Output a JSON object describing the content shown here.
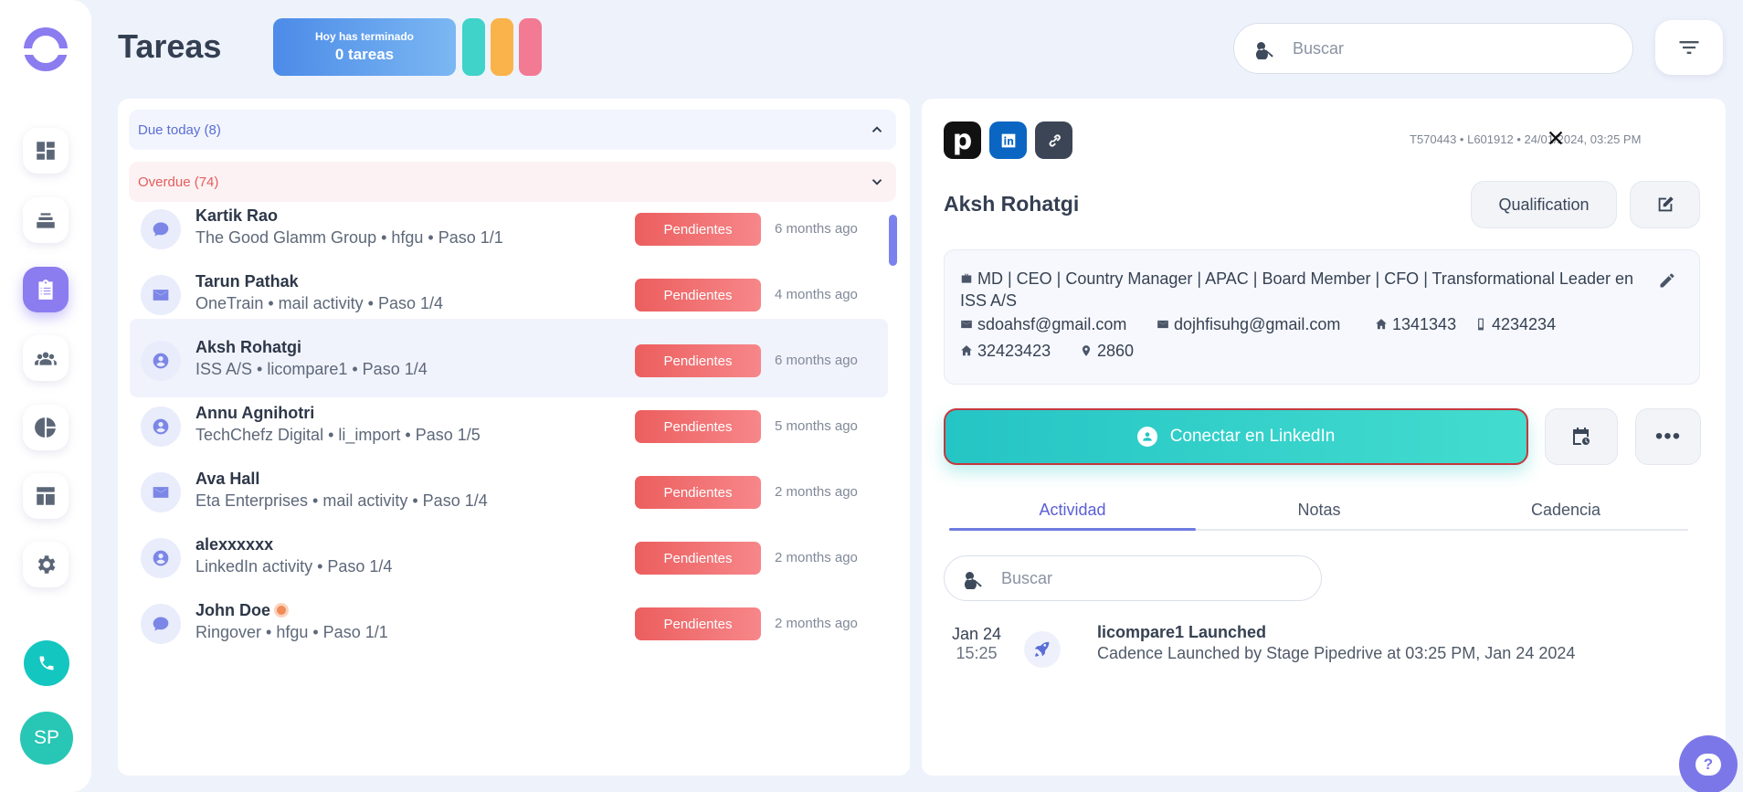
{
  "header": {
    "title": "Tareas",
    "progress_line1": "Hoy has terminado",
    "progress_line2": "0 tareas",
    "pill_colors": [
      "#3fd3c9",
      "#f9b34a",
      "#f27a92"
    ],
    "search_placeholder": "Buscar"
  },
  "sidebar": {
    "items": [
      {
        "name": "dashboard-icon"
      },
      {
        "name": "stack-icon"
      },
      {
        "name": "tasks-icon",
        "active": true
      },
      {
        "name": "team-icon"
      },
      {
        "name": "pie-chart-icon"
      },
      {
        "name": "layout-icon"
      },
      {
        "name": "settings-icon"
      }
    ],
    "avatar_initials": "SP"
  },
  "list": {
    "due_today": "Due today (8)",
    "overdue": "Overdue (74)",
    "rows": [
      {
        "icon": "chat-icon",
        "name": "Kartik Rao",
        "sub": "The Good Glamm Group • hfgu • Paso 1/1",
        "badge": "Pendientes",
        "ago": "6 months ago"
      },
      {
        "icon": "mail-icon",
        "name": "Tarun Pathak",
        "sub": "OneTrain • mail activity • Paso 1/4",
        "badge": "Pendientes",
        "ago": "4 months ago"
      },
      {
        "icon": "user-icon",
        "name": "Aksh Rohatgi",
        "sub": "ISS A/S • licompare1 • Paso 1/4",
        "badge": "Pendientes",
        "ago": "6 months ago"
      },
      {
        "icon": "user-icon",
        "name": "Annu Agnihotri",
        "sub": "TechChefz Digital • li_import • Paso 1/5",
        "badge": "Pendientes",
        "ago": "5 months ago"
      },
      {
        "icon": "mail-icon",
        "name": "Ava Hall",
        "sub": "Eta Enterprises • mail activity • Paso 1/4",
        "badge": "Pendientes",
        "ago": "2 months ago"
      },
      {
        "icon": "user-icon",
        "name": "alexxxxxx",
        "sub": "LinkedIn activity • Paso 1/4",
        "badge": "Pendientes",
        "ago": "2 months ago"
      },
      {
        "icon": "chat-icon",
        "name": "John Doe",
        "sub": "Ringover • hfgu • Paso 1/1",
        "badge": "Pendientes",
        "ago": "2 months ago"
      }
    ]
  },
  "detail": {
    "pipedrive_letter": "p",
    "meta": "T570443 • L601912 • 24/01/2024, 03:25 PM",
    "name": "Aksh Rohatgi",
    "qualification": "Qualification",
    "headline": "MD | CEO | Country Manager | APAC | Board Member | CFO | Transformational Leader en ISS A/S",
    "email1": "sdoahsf@gmail.com",
    "email2": "dojhfisuhg@gmail.com",
    "phone_home": "1341343",
    "phone_mobile": "4234234",
    "phone_home2": "32423423",
    "location": "2860",
    "linkedin_cta": "Conectar en LinkedIn",
    "tabs": [
      "Actividad",
      "Notas",
      "Cadencia"
    ],
    "search_placeholder": "Buscar",
    "activity": {
      "date": "Jan 24",
      "time": "15:25",
      "title": "licompare1 Launched",
      "desc": "Cadence Launched by Stage Pipedrive at 03:25 PM, Jan 24 2024"
    }
  },
  "help_label": "?"
}
